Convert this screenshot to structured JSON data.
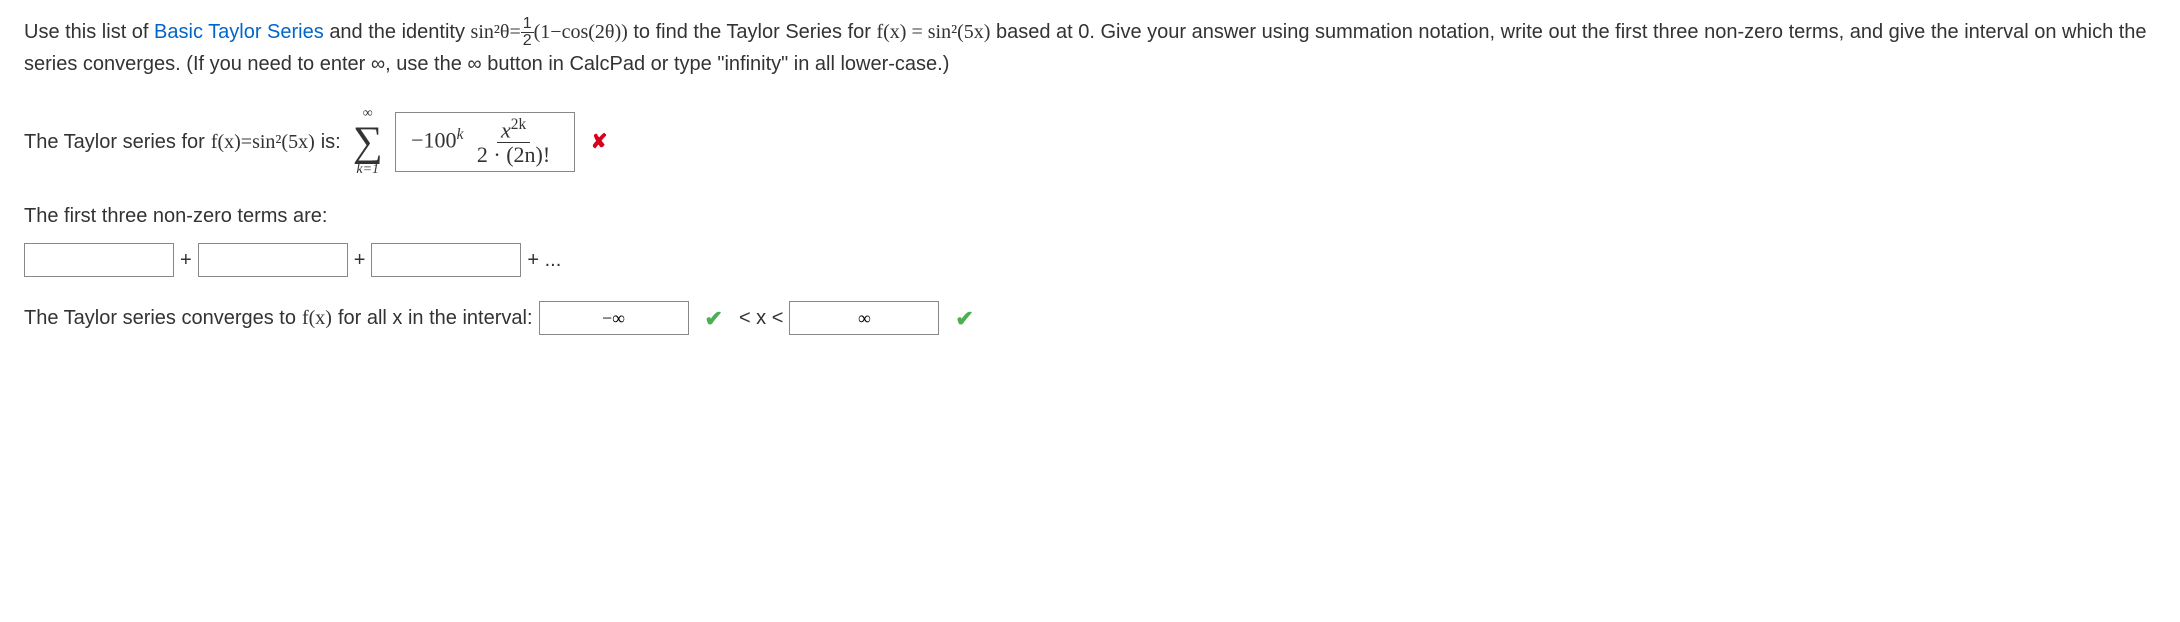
{
  "prompt": {
    "part1": "Use this list of ",
    "link": "Basic Taylor Series",
    "part2": " and the identity  ",
    "identity_lhs": "sin²θ=",
    "identity_frac_num": "1",
    "identity_frac_den": "2",
    "identity_rhs": "(1−cos(2θ))",
    "part3": "  to find the Taylor Series for  ",
    "fx_label": "f(x) = sin²(5x)",
    "part4": "  based at 0. Give your answer using summation notation, write out the first three non-zero terms, and give the interval on which the series converges. (If you need to enter ∞, use the ∞ button in CalcPad or type \"infinity\" in all lower-case.)"
  },
  "series": {
    "label_part1": "The Taylor series for  ",
    "label_fx": "f(x)=sin²(5x)",
    "label_part2": "  is:",
    "sum_top": "∞",
    "sum_bottom": "k=1",
    "answer_prefix": "−100",
    "answer_exp": "k",
    "frac_num_var": "x",
    "frac_num_exp": "2k",
    "frac_den": "2 · (2n)!"
  },
  "terms": {
    "label": "The first three non-zero terms are:",
    "t1": "",
    "t2": "",
    "t3": "",
    "plus": "+",
    "ellipsis": "+ ..."
  },
  "interval": {
    "label": "The Taylor series converges to  ",
    "fx": "f(x)",
    "label2": "  for all x in the interval:",
    "lower": "−∞",
    "between": "< x <",
    "upper": "∞"
  },
  "marks": {
    "wrong": "✘",
    "correct": "✔"
  }
}
